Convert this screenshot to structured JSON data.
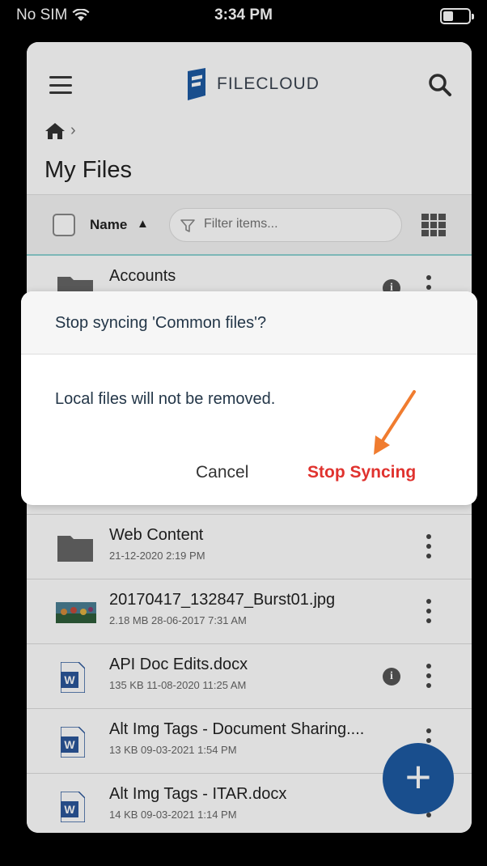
{
  "status_bar": {
    "carrier": "No SIM",
    "time": "3:34 PM"
  },
  "header": {
    "logo_text": "FILECLOUD",
    "title": "My Files"
  },
  "toolbar": {
    "sort_label": "Name",
    "sort_arrow": "▲",
    "filter_placeholder": "Filter items..."
  },
  "files": [
    {
      "name": "Accounts",
      "meta": "",
      "icon": "folder-icon",
      "has_info": true
    },
    {
      "name": "Web Content",
      "meta": "21-12-2020 2:19 PM",
      "icon": "folder-icon",
      "has_info": false
    },
    {
      "name": "20170417_132847_Burst01.jpg",
      "meta": "2.18 MB 28-06-2017 7:31 AM",
      "icon": "image-thumbnail-icon",
      "has_info": false
    },
    {
      "name": "API Doc Edits.docx",
      "meta": "135 KB 11-08-2020 11:25 AM",
      "icon": "word-document-icon",
      "has_info": true
    },
    {
      "name": "Alt Img Tags - Document Sharing....",
      "meta": "13 KB 09-03-2021 1:54 PM",
      "icon": "word-document-icon",
      "has_info": false
    },
    {
      "name": "Alt Img Tags - ITAR.docx",
      "meta": "14 KB 09-03-2021 1:14 PM",
      "icon": "word-document-icon",
      "has_info": false
    }
  ],
  "fab": {
    "label": "+"
  },
  "dialog": {
    "title": "Stop syncing 'Common files'?",
    "message": "Local files will not be removed.",
    "cancel_label": "Cancel",
    "confirm_label": "Stop Syncing"
  },
  "colors": {
    "accent": "#1d5aa3",
    "danger": "#e0322e",
    "arrow": "#f07c2f",
    "toolbar_border": "#8fd3d3"
  }
}
